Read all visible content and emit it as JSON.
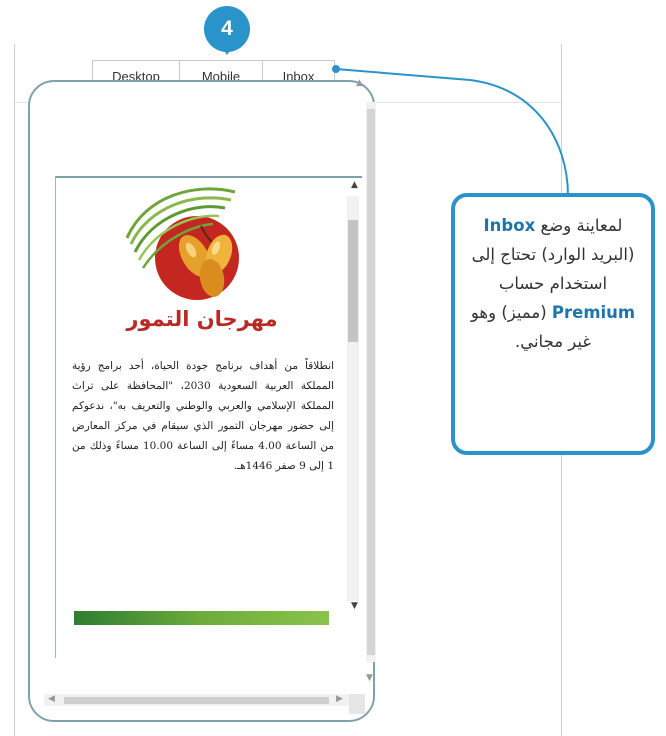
{
  "step_badge": "4",
  "toolbar": {
    "tabs": [
      {
        "label": "Desktop"
      },
      {
        "label": "Mobile"
      },
      {
        "label": "Inbox"
      }
    ],
    "selected": "Mobile"
  },
  "preview": {
    "title": "مهرجان التمور",
    "body": "انطلاقاً من أهداف برنامج جودة الحياة، أحد برامج رؤية المملكة العربية السعودية 2030، \"المحافظة على تراث المملكة الإسلامي والعربي والوطني والتعريف به\"، ندعوكم إلى حضور مهرجان التمور الذي سيقام في مركز المعارض من الساعة 4.00 مساءً إلى الساعة 10.00 مساءً وذلك من 1 إلى 9 صفر 1446هـ."
  },
  "callout": {
    "part1": "لمعاينة وضع ",
    "inbox": "Inbox",
    "part2": " (البريد الوارد) تحتاج إلى استخدام حساب ",
    "premium": "Premium",
    "part3": " (مميز) وهو غير مجاني."
  },
  "colors": {
    "accent": "#2a93c9",
    "title_red": "#b92a26",
    "frame": "#7fa2aa"
  }
}
